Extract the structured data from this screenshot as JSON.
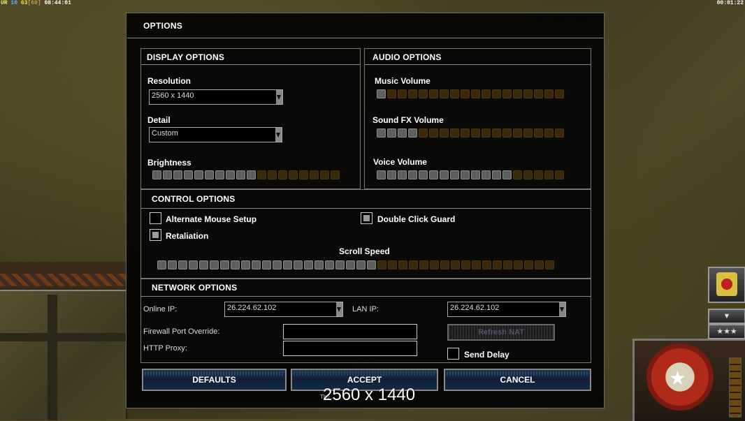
{
  "hud": {
    "left_a": "UR",
    "left_b": "10",
    "left_c": "63",
    "left_d": "[60]",
    "left_time": "08:44:01",
    "right_time": "00:01:22"
  },
  "dialog": {
    "title": "OPTIONS"
  },
  "display": {
    "heading": "DISPLAY OPTIONS",
    "resolution_label": "Resolution",
    "resolution_value": "2560 x 1440",
    "detail_label": "Detail",
    "detail_value": "Custom",
    "brightness_label": "Brightness",
    "brightness_level": 10,
    "brightness_max": 18
  },
  "audio": {
    "heading": "AUDIO OPTIONS",
    "music_label": "Music Volume",
    "music_level": 1,
    "music_max": 18,
    "sfx_label": "Sound FX Volume",
    "sfx_level": 4,
    "sfx_max": 18,
    "voice_label": "Voice Volume",
    "voice_level": 13,
    "voice_max": 18
  },
  "control": {
    "heading": "CONTROL OPTIONS",
    "alt_mouse_label": "Alternate Mouse Setup",
    "alt_mouse_checked": false,
    "double_click_label": "Double Click Guard",
    "double_click_checked": true,
    "retaliation_label": "Retaliation",
    "retaliation_checked": true,
    "scroll_label": "Scroll Speed",
    "scroll_level": 21,
    "scroll_max": 38
  },
  "network": {
    "heading": "NETWORK OPTIONS",
    "online_ip_label": "Online IP:",
    "online_ip_value": "26.224.62.102",
    "lan_ip_label": "LAN IP:",
    "lan_ip_value": "26.224.62.102",
    "firewall_label": "Firewall Port Override:",
    "firewall_value": "",
    "proxy_label": "HTTP Proxy:",
    "proxy_value": "",
    "refresh_nat_label": "Refresh NAT",
    "send_delay_label": "Send Delay",
    "send_delay_checked": false
  },
  "buttons": {
    "defaults": "DEFAULTS",
    "accept": "ACCEPT",
    "cancel": "CANCEL"
  },
  "footer": {
    "version": "The ...",
    "overlay_resolution": "2560 x 1440"
  },
  "side": {
    "button2": "▼",
    "button3": "★★★"
  }
}
